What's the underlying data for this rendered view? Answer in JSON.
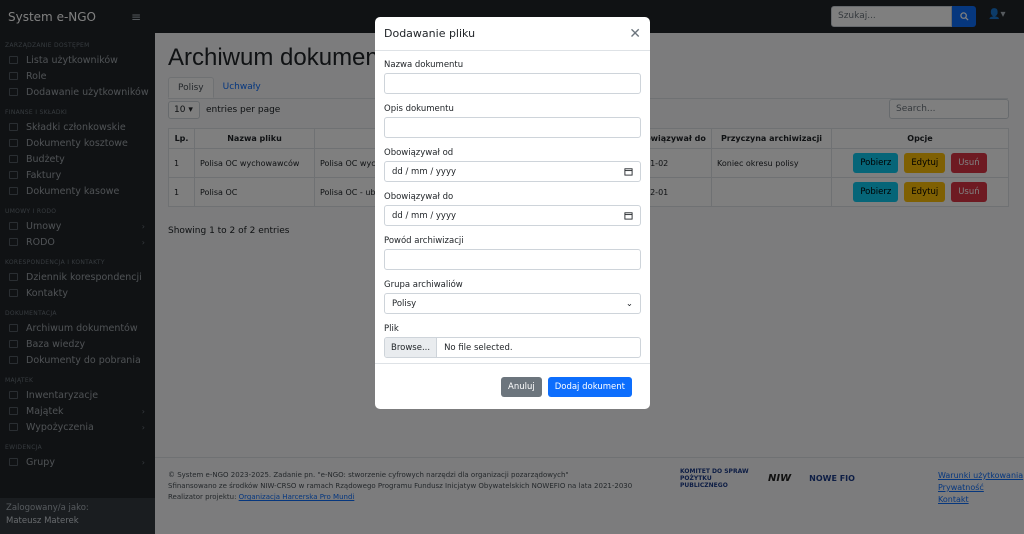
{
  "topbar": {
    "brand": "System e-NGO",
    "search_placeholder": "Szukaj..."
  },
  "sidebar": {
    "sections": [
      {
        "title": "ZARZĄDZANIE DOSTĘPEM",
        "items": [
          {
            "label": "Lista użytkowników",
            "icon": "users-icon"
          },
          {
            "label": "Role",
            "icon": "roles-icon"
          },
          {
            "label": "Dodawanie użytkowników",
            "icon": "user-add-icon",
            "chevron": true
          }
        ]
      },
      {
        "title": "FINANSE I SKŁADKI",
        "items": [
          {
            "label": "Składki członkowskie",
            "icon": "coins-icon"
          },
          {
            "label": "Dokumenty kosztowe",
            "icon": "doc-icon"
          },
          {
            "label": "Budżety",
            "icon": "budget-icon"
          },
          {
            "label": "Faktury",
            "icon": "invoice-icon"
          },
          {
            "label": "Dokumenty kasowe",
            "icon": "cash-icon"
          }
        ]
      },
      {
        "title": "UMOWY I RODO",
        "items": [
          {
            "label": "Umowy",
            "icon": "contract-icon",
            "chevron": true
          },
          {
            "label": "RODO",
            "icon": "rodo-icon",
            "chevron": true
          }
        ]
      },
      {
        "title": "KORESPONDENCJA I KONTAKTY",
        "items": [
          {
            "label": "Dziennik korespondencji",
            "icon": "mail-icon"
          },
          {
            "label": "Kontakty",
            "icon": "contacts-icon"
          }
        ]
      },
      {
        "title": "DOKUMENTACJA",
        "items": [
          {
            "label": "Archiwum dokumentów",
            "icon": "archive-icon"
          },
          {
            "label": "Baza wiedzy",
            "icon": "book-icon"
          },
          {
            "label": "Dokumenty do pobrania",
            "icon": "download-icon"
          }
        ]
      },
      {
        "title": "MAJĄTEK",
        "items": [
          {
            "label": "Inwentaryzacje",
            "icon": "inventory-icon"
          },
          {
            "label": "Majątek",
            "icon": "assets-icon",
            "chevron": true
          },
          {
            "label": "Wypożyczenia",
            "icon": "loan-icon",
            "chevron": true
          }
        ]
      },
      {
        "title": "EWIDENCJA",
        "items": [
          {
            "label": "Grupy",
            "icon": "groups-icon",
            "chevron": true
          }
        ]
      }
    ],
    "footer": {
      "logged_as": "Zalogowany/a jako:",
      "user": "Mateusz Materek"
    }
  },
  "main": {
    "title": "Archiwum dokument",
    "tabs": [
      "Polisy",
      "Uchwały"
    ],
    "entries_value": "10",
    "entries_label": "entries per page",
    "search_placeholder": "Search...",
    "columns": [
      "Lp.",
      "Nazwa pliku",
      "",
      "",
      "",
      "owiązywał do",
      "Przyczyna archiwizacji",
      "Opcje"
    ],
    "rows": [
      {
        "lp": "1",
        "name": "Polisa OC wychowawców",
        "desc": "Polisa OC wyc",
        "to": "01-02",
        "reason": "Koniec okresu polisy"
      },
      {
        "lp": "1",
        "name": "Polisa OC",
        "desc": "Polisa OC - ub",
        "to": "02-01",
        "reason": ""
      }
    ],
    "row_buttons": {
      "download": "Pobierz",
      "edit": "Edytuj",
      "delete": "Usuń"
    },
    "showing": "Showing 1 to 2 of 2 entries"
  },
  "footer": {
    "line1": "© System e-NGO 2023-2025. Zadanie pn. \"e-NGO: stworzenie cyfrowych narzędzi dla organizacji pozarządowych\"",
    "line2": "Sfinansowano ze środków NIW-CRSO w ramach Rządowego Programu Fundusz Inicjatyw Obywatelskich NOWEFIO na lata 2021-2030",
    "line3_prefix": "Realizator projektu: ",
    "line3_link": "Organizacja Harcerska Pro Mundi",
    "logo1": "KOMITET DO SPRAW POŻYTKU PUBLICZNEGO",
    "logo2": "NIW",
    "logo3": "NOWE FIO",
    "links": [
      "Warunki użytkowania",
      "Prywatność",
      "Kontakt"
    ]
  },
  "modal": {
    "title": "Dodawanie pliku",
    "fields": {
      "name_label": "Nazwa dokumentu",
      "desc_label": "Opis dokumentu",
      "from_label": "Obowiązywał od",
      "from_value": "dd / mm / yyyy",
      "to_label": "Obowiązywał do",
      "to_value": "dd / mm / yyyy",
      "reason_label": "Powód archiwizacji",
      "group_label": "Grupa archiwaliów",
      "group_value": "Polisy",
      "file_label": "Plik",
      "browse": "Browse...",
      "no_file": "No file selected."
    },
    "cancel": "Anuluj",
    "submit": "Dodaj dokument"
  }
}
